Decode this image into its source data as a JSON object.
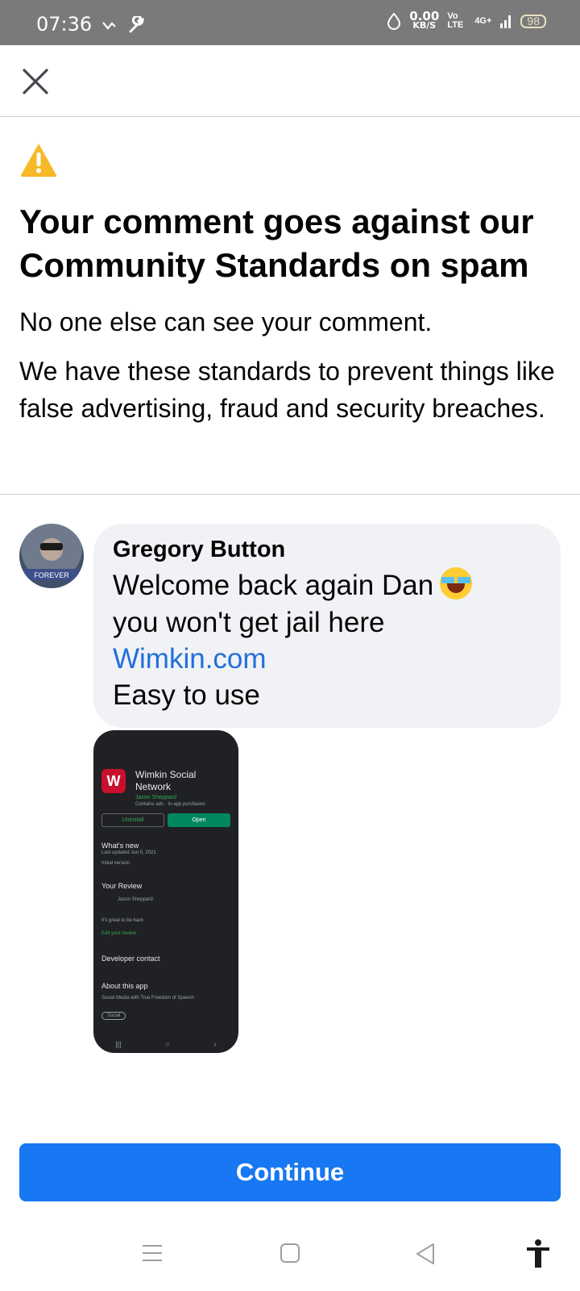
{
  "status_bar": {
    "time": "07:36",
    "net_speed_value": "0.00",
    "net_speed_unit": "KB/S",
    "volte": "Vo LTE",
    "network": "4G+",
    "battery": "98"
  },
  "topbar": {
    "close_icon": "close-icon"
  },
  "notice": {
    "warning_icon": "warning-triangle-icon",
    "warning_color": "#f7b928",
    "title": "Your comment goes against our Community Standards on spam",
    "lead": "No one else can see your comment.",
    "body": "We have these standards to prevent things like false advertising, fraud and security breaches."
  },
  "comment": {
    "author": "Gregory Button",
    "line1": "Welcome back again Dan",
    "emoji_icon": "laughing-tears-emoji-icon",
    "line2": "you won't get jail here",
    "link": "Wimkin.com",
    "line4": "Easy to use",
    "avatar_text": "FOREVER",
    "attachment": {
      "app_icon_letter": "W",
      "app_title": "Wimkin Social Network",
      "developer": "Jason Sheppard",
      "meta": "Contains ads · In-app purchases",
      "uninstall": "Uninstall",
      "open": "Open",
      "whats_new": "What's new",
      "last_updated": "Last updated Jun 5, 2021",
      "initial_version": "Initial version",
      "your_review": "Your Review",
      "reviewer": "Jason Sheppard",
      "review_text": "It's great to be back",
      "edit_review": "Edit your review",
      "developer_contact": "Developer contact",
      "about": "About this app",
      "about_desc": "Social Media with True Freedom of Speech",
      "tag": "Social"
    }
  },
  "actions": {
    "continue_label": "Continue",
    "accent": "#1877f2"
  },
  "nav": {
    "menu_icon": "recents-icon",
    "home_icon": "home-icon",
    "back_icon": "back-icon",
    "accessibility_icon": "accessibility-icon"
  }
}
